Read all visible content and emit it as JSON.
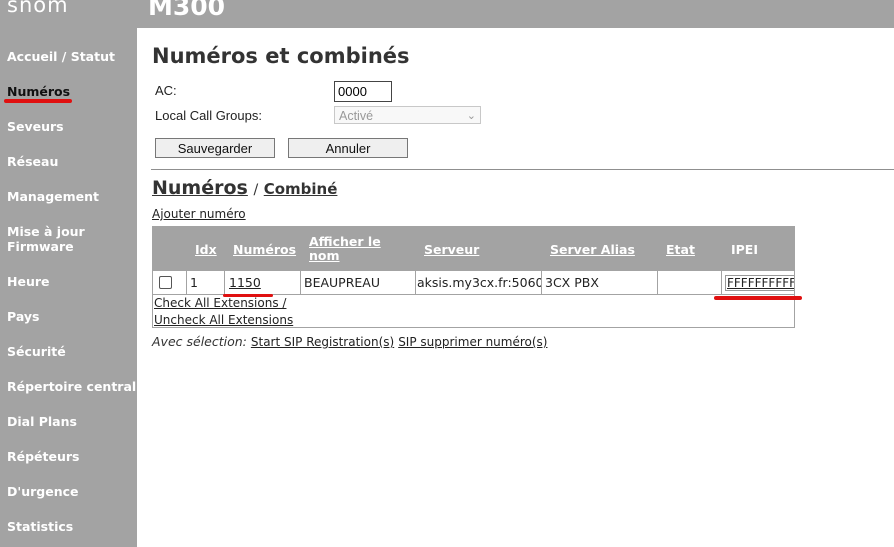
{
  "header": {
    "logo": "snom",
    "model": "M300"
  },
  "sidebar": {
    "items": [
      {
        "label": "Accueil / Statut"
      },
      {
        "label": "Numéros",
        "active": true
      },
      {
        "label": "Seveurs"
      },
      {
        "label": "Réseau"
      },
      {
        "label": "Management"
      },
      {
        "label": "Mise à jour Firmware"
      },
      {
        "label": "Heure"
      },
      {
        "label": "Pays"
      },
      {
        "label": "Sécurité"
      },
      {
        "label": "Répertoire central"
      },
      {
        "label": "Dial Plans"
      },
      {
        "label": "Répéteurs"
      },
      {
        "label": "D'urgence"
      },
      {
        "label": "Statistics"
      }
    ]
  },
  "page": {
    "title": "Numéros et combinés"
  },
  "form": {
    "ac_label": "AC:",
    "ac_value": "0000",
    "lcg_label": "Local Call Groups:",
    "lcg_selected": "Activé",
    "save_label": "Sauvegarder",
    "cancel_label": "Annuler"
  },
  "section": {
    "tab_numbers": "Numéros",
    "separator": "/",
    "tab_handset": "Combiné",
    "add_number": "Ajouter numéro"
  },
  "table": {
    "headers": [
      "Idx",
      "Numéros",
      "Afficher le nom",
      "Serveur",
      "Server Alias",
      "Etat",
      "IPEI"
    ],
    "rows": [
      {
        "idx": "1",
        "number": "1150",
        "display_name": "BEAUPREAU",
        "server": "aksis.my3cx.fr:5060",
        "server_alias": "3CX PBX",
        "state": "",
        "ipei": "FFFFFFFFFF"
      }
    ],
    "check_all": "Check All Extensions /",
    "uncheck_all": "Uncheck All Extensions"
  },
  "bulk_actions": {
    "label": "Avec sélection:",
    "start_registration": "Start SIP Registration(s)",
    "delete_numbers": "SIP supprimer numéro(s)"
  },
  "colors": {
    "sidebar_bg": "#a3a3a3",
    "highlight_mark": "#e01010"
  }
}
